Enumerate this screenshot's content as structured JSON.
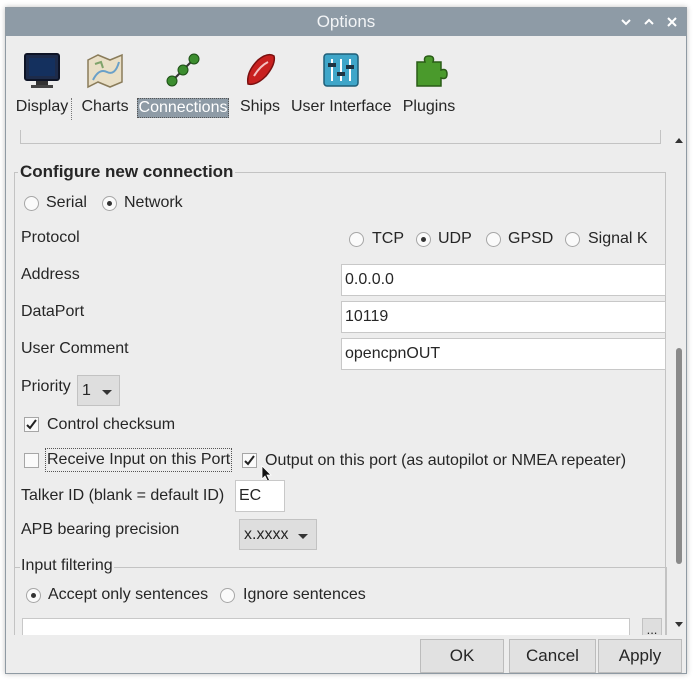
{
  "window": {
    "title": "Options"
  },
  "toolbar": {
    "items": [
      {
        "label": "Display",
        "icon": "display-icon"
      },
      {
        "label": "Charts",
        "icon": "charts-icon"
      },
      {
        "label": "Connections",
        "icon": "connections-icon",
        "selected": true
      },
      {
        "label": "Ships",
        "icon": "ships-icon"
      },
      {
        "label": "User Interface",
        "icon": "user-interface-icon"
      },
      {
        "label": "Plugins",
        "icon": "plugins-icon"
      }
    ]
  },
  "config": {
    "section_title": "Configure new connection",
    "conn_type": {
      "serial": "Serial",
      "network": "Network",
      "selected": "Network"
    },
    "protocol": {
      "label": "Protocol",
      "options": [
        "TCP",
        "UDP",
        "GPSD",
        "Signal K"
      ],
      "selected": "UDP"
    },
    "address": {
      "label": "Address",
      "value": "0.0.0.0"
    },
    "dataport": {
      "label": "DataPort",
      "value": "10119"
    },
    "comment": {
      "label": "User Comment",
      "value": "opencpnOUT"
    },
    "priority": {
      "label": "Priority",
      "value": "1"
    },
    "control_checksum": {
      "label": "Control checksum",
      "checked": true
    },
    "receive_input": {
      "label": "Receive Input on this Port",
      "checked": false
    },
    "output_port": {
      "label": "Output on this port (as autopilot or NMEA repeater)",
      "checked": true
    },
    "talker_id": {
      "label": "Talker ID (blank = default ID)",
      "value": "EC"
    },
    "apb": {
      "label": "APB bearing precision",
      "value": "x.xxxx"
    },
    "input_filtering": {
      "label": "Input filtering",
      "accept": "Accept only sentences",
      "ignore": "Ignore sentences",
      "selected": "accept",
      "browse": "..."
    }
  },
  "buttons": {
    "ok": "OK",
    "cancel": "Cancel",
    "apply": "Apply"
  },
  "colors": {
    "titlebar": "#8e9ba6",
    "selected_tab": "#8e9ba6",
    "background": "#ededed"
  }
}
